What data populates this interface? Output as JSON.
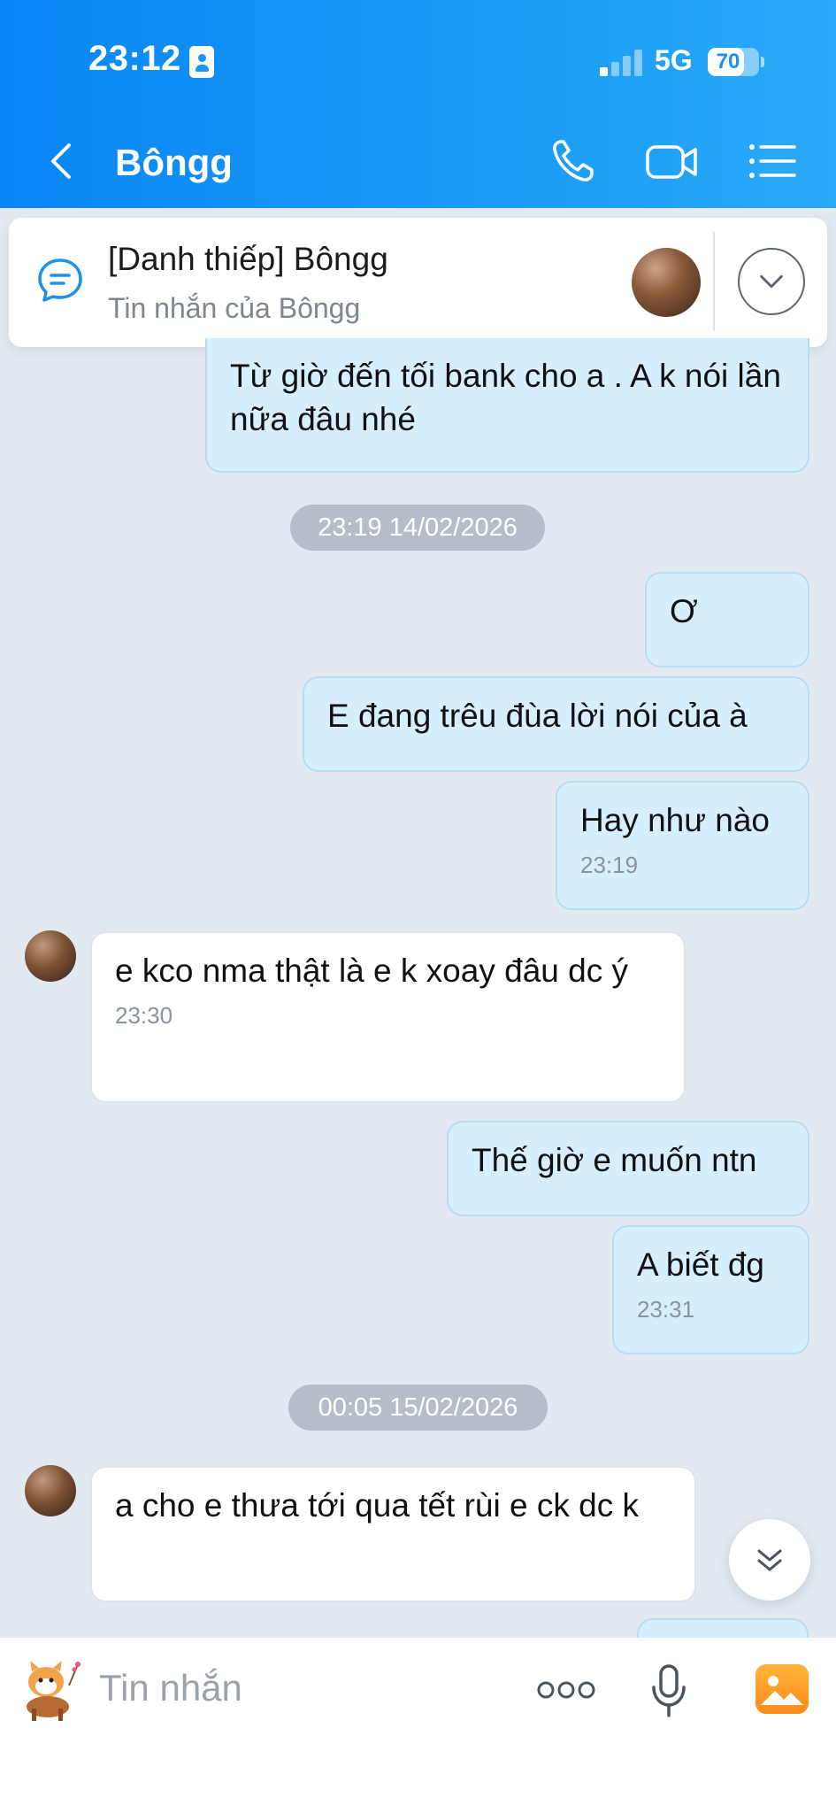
{
  "status_bar": {
    "time": "23:12",
    "network": "5G",
    "battery": "70",
    "battery_level": 0.7
  },
  "header": {
    "title": "Bôngg"
  },
  "pinned": {
    "title": "[Danh thiếp] Bôngg",
    "subtitle": "Tin nhắn của Bôngg"
  },
  "messages": [
    {
      "text": "Từ giờ đến tối bank cho a . A k nói lần nữa đâu nhé"
    },
    {
      "date": "23:19 14/02/2026"
    },
    {
      "text": "Ơ"
    },
    {
      "text": "E đang trêu đùa lời nói của à"
    },
    {
      "text": "Hay như nào",
      "time": "23:19"
    },
    {
      "text": "e kco nma thật là e k xoay đâu dc ý",
      "time": "23:30"
    },
    {
      "text": "Thế giờ e muốn ntn"
    },
    {
      "text": "A biết đg",
      "time": "23:31"
    },
    {
      "date": "00:05 15/02/2026"
    },
    {
      "text": "a cho e thưa tới qua tết rùi e ck dc k"
    }
  ],
  "input": {
    "placeholder": "Tin nhắn"
  },
  "colors": {
    "header": "#0a85f5",
    "outgoing_bubble": "#d6efff",
    "incoming_bubble": "#ffffff",
    "background": "#e2e9f1"
  }
}
